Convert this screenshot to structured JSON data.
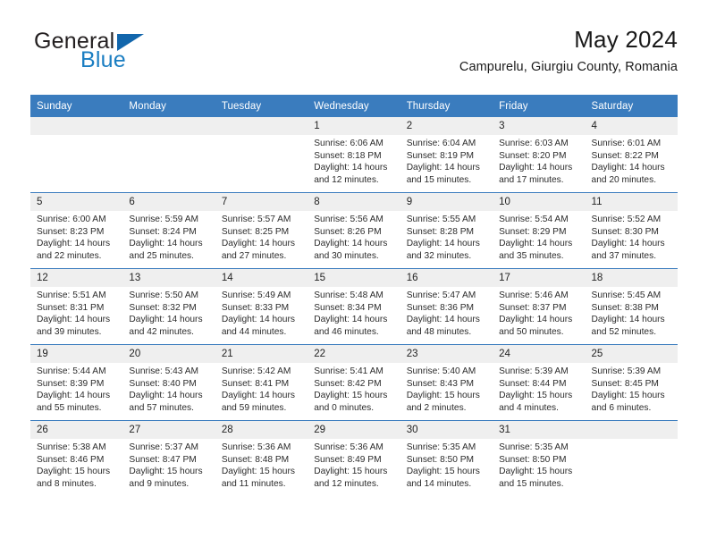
{
  "brand": {
    "name_top": "General",
    "name_bottom": "Blue",
    "accent_color": "#1b7ec2",
    "triangle_color": "#1266ac"
  },
  "header": {
    "title": "May 2024",
    "subtitle": "Campurelu, Giurgiu County, Romania"
  },
  "calendar": {
    "header_bg": "#3a7cbe",
    "daynum_bg": "#efefef",
    "weekdays": [
      "Sunday",
      "Monday",
      "Tuesday",
      "Wednesday",
      "Thursday",
      "Friday",
      "Saturday"
    ],
    "weeks": [
      [
        {
          "day": "",
          "lines": []
        },
        {
          "day": "",
          "lines": []
        },
        {
          "day": "",
          "lines": []
        },
        {
          "day": "1",
          "lines": [
            "Sunrise: 6:06 AM",
            "Sunset: 8:18 PM",
            "Daylight: 14 hours",
            "and 12 minutes."
          ]
        },
        {
          "day": "2",
          "lines": [
            "Sunrise: 6:04 AM",
            "Sunset: 8:19 PM",
            "Daylight: 14 hours",
            "and 15 minutes."
          ]
        },
        {
          "day": "3",
          "lines": [
            "Sunrise: 6:03 AM",
            "Sunset: 8:20 PM",
            "Daylight: 14 hours",
            "and 17 minutes."
          ]
        },
        {
          "day": "4",
          "lines": [
            "Sunrise: 6:01 AM",
            "Sunset: 8:22 PM",
            "Daylight: 14 hours",
            "and 20 minutes."
          ]
        }
      ],
      [
        {
          "day": "5",
          "lines": [
            "Sunrise: 6:00 AM",
            "Sunset: 8:23 PM",
            "Daylight: 14 hours",
            "and 22 minutes."
          ]
        },
        {
          "day": "6",
          "lines": [
            "Sunrise: 5:59 AM",
            "Sunset: 8:24 PM",
            "Daylight: 14 hours",
            "and 25 minutes."
          ]
        },
        {
          "day": "7",
          "lines": [
            "Sunrise: 5:57 AM",
            "Sunset: 8:25 PM",
            "Daylight: 14 hours",
            "and 27 minutes."
          ]
        },
        {
          "day": "8",
          "lines": [
            "Sunrise: 5:56 AM",
            "Sunset: 8:26 PM",
            "Daylight: 14 hours",
            "and 30 minutes."
          ]
        },
        {
          "day": "9",
          "lines": [
            "Sunrise: 5:55 AM",
            "Sunset: 8:28 PM",
            "Daylight: 14 hours",
            "and 32 minutes."
          ]
        },
        {
          "day": "10",
          "lines": [
            "Sunrise: 5:54 AM",
            "Sunset: 8:29 PM",
            "Daylight: 14 hours",
            "and 35 minutes."
          ]
        },
        {
          "day": "11",
          "lines": [
            "Sunrise: 5:52 AM",
            "Sunset: 8:30 PM",
            "Daylight: 14 hours",
            "and 37 minutes."
          ]
        }
      ],
      [
        {
          "day": "12",
          "lines": [
            "Sunrise: 5:51 AM",
            "Sunset: 8:31 PM",
            "Daylight: 14 hours",
            "and 39 minutes."
          ]
        },
        {
          "day": "13",
          "lines": [
            "Sunrise: 5:50 AM",
            "Sunset: 8:32 PM",
            "Daylight: 14 hours",
            "and 42 minutes."
          ]
        },
        {
          "day": "14",
          "lines": [
            "Sunrise: 5:49 AM",
            "Sunset: 8:33 PM",
            "Daylight: 14 hours",
            "and 44 minutes."
          ]
        },
        {
          "day": "15",
          "lines": [
            "Sunrise: 5:48 AM",
            "Sunset: 8:34 PM",
            "Daylight: 14 hours",
            "and 46 minutes."
          ]
        },
        {
          "day": "16",
          "lines": [
            "Sunrise: 5:47 AM",
            "Sunset: 8:36 PM",
            "Daylight: 14 hours",
            "and 48 minutes."
          ]
        },
        {
          "day": "17",
          "lines": [
            "Sunrise: 5:46 AM",
            "Sunset: 8:37 PM",
            "Daylight: 14 hours",
            "and 50 minutes."
          ]
        },
        {
          "day": "18",
          "lines": [
            "Sunrise: 5:45 AM",
            "Sunset: 8:38 PM",
            "Daylight: 14 hours",
            "and 52 minutes."
          ]
        }
      ],
      [
        {
          "day": "19",
          "lines": [
            "Sunrise: 5:44 AM",
            "Sunset: 8:39 PM",
            "Daylight: 14 hours",
            "and 55 minutes."
          ]
        },
        {
          "day": "20",
          "lines": [
            "Sunrise: 5:43 AM",
            "Sunset: 8:40 PM",
            "Daylight: 14 hours",
            "and 57 minutes."
          ]
        },
        {
          "day": "21",
          "lines": [
            "Sunrise: 5:42 AM",
            "Sunset: 8:41 PM",
            "Daylight: 14 hours",
            "and 59 minutes."
          ]
        },
        {
          "day": "22",
          "lines": [
            "Sunrise: 5:41 AM",
            "Sunset: 8:42 PM",
            "Daylight: 15 hours",
            "and 0 minutes."
          ]
        },
        {
          "day": "23",
          "lines": [
            "Sunrise: 5:40 AM",
            "Sunset: 8:43 PM",
            "Daylight: 15 hours",
            "and 2 minutes."
          ]
        },
        {
          "day": "24",
          "lines": [
            "Sunrise: 5:39 AM",
            "Sunset: 8:44 PM",
            "Daylight: 15 hours",
            "and 4 minutes."
          ]
        },
        {
          "day": "25",
          "lines": [
            "Sunrise: 5:39 AM",
            "Sunset: 8:45 PM",
            "Daylight: 15 hours",
            "and 6 minutes."
          ]
        }
      ],
      [
        {
          "day": "26",
          "lines": [
            "Sunrise: 5:38 AM",
            "Sunset: 8:46 PM",
            "Daylight: 15 hours",
            "and 8 minutes."
          ]
        },
        {
          "day": "27",
          "lines": [
            "Sunrise: 5:37 AM",
            "Sunset: 8:47 PM",
            "Daylight: 15 hours",
            "and 9 minutes."
          ]
        },
        {
          "day": "28",
          "lines": [
            "Sunrise: 5:36 AM",
            "Sunset: 8:48 PM",
            "Daylight: 15 hours",
            "and 11 minutes."
          ]
        },
        {
          "day": "29",
          "lines": [
            "Sunrise: 5:36 AM",
            "Sunset: 8:49 PM",
            "Daylight: 15 hours",
            "and 12 minutes."
          ]
        },
        {
          "day": "30",
          "lines": [
            "Sunrise: 5:35 AM",
            "Sunset: 8:50 PM",
            "Daylight: 15 hours",
            "and 14 minutes."
          ]
        },
        {
          "day": "31",
          "lines": [
            "Sunrise: 5:35 AM",
            "Sunset: 8:50 PM",
            "Daylight: 15 hours",
            "and 15 minutes."
          ]
        },
        {
          "day": "",
          "lines": []
        }
      ]
    ]
  }
}
